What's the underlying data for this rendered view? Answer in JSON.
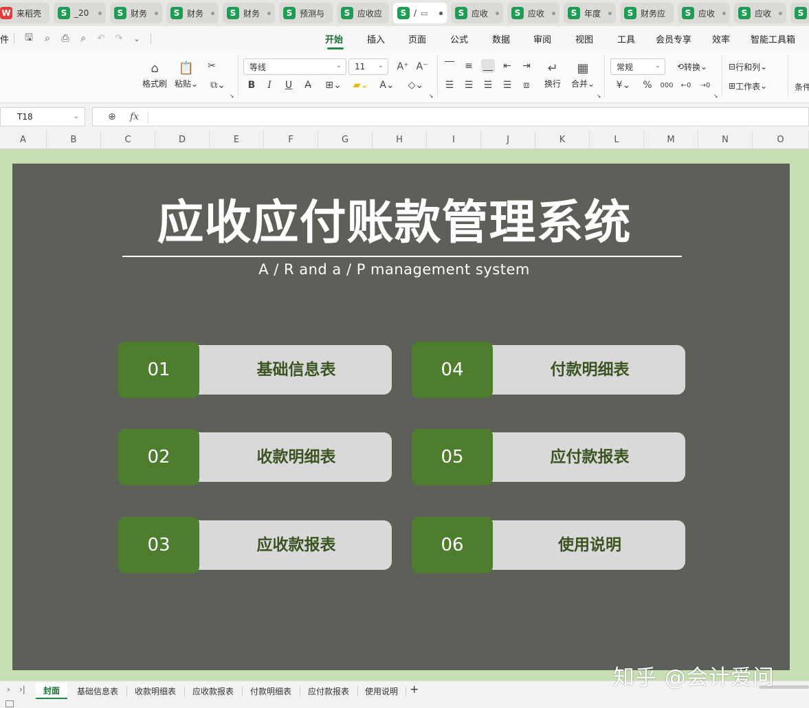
{
  "tabs": [
    {
      "icon": "W",
      "red": true,
      "title": "来稻壳"
    },
    {
      "icon": "S",
      "title": "_20"
    },
    {
      "icon": "S",
      "title": "财务"
    },
    {
      "icon": "S",
      "title": "财务"
    },
    {
      "icon": "S",
      "title": "财务"
    },
    {
      "icon": "S",
      "title": "预测与"
    },
    {
      "icon": "S",
      "title": "应收应"
    },
    {
      "icon": "S",
      "title": "/"
    },
    {
      "icon": "S",
      "title": "应收"
    },
    {
      "icon": "S",
      "title": "应收"
    },
    {
      "icon": "S",
      "title": "年度"
    },
    {
      "icon": "S",
      "title": "财务应"
    },
    {
      "icon": "S",
      "title": "应收"
    },
    {
      "icon": "S",
      "title": "应收"
    },
    {
      "icon": "S",
      "title": ""
    }
  ],
  "menu": {
    "file_partial": "件",
    "items": [
      "开始",
      "插入",
      "页面",
      "公式",
      "数据",
      "审阅",
      "视图",
      "工具",
      "会员专享",
      "效率",
      "智能工具箱"
    ]
  },
  "ribbon": {
    "format_painter": "格式刷",
    "paste": "粘贴",
    "font_name": "等线",
    "font_size": "11",
    "wrap": "换行",
    "merge": "合并",
    "number_format": "常规",
    "convert": "转换",
    "row_col": "行和列",
    "worksheet": "工作表",
    "cond_partial": "条件",
    "percent": "%",
    "yen": "¥",
    "bold": "B",
    "italic": "I",
    "underline": "U"
  },
  "formula": {
    "cell_ref": "T18",
    "fx": "fx",
    "value": ""
  },
  "columns": [
    "A",
    "B",
    "C",
    "D",
    "E",
    "F",
    "G",
    "H",
    "I",
    "J",
    "K",
    "L",
    "M",
    "N",
    "O"
  ],
  "cover": {
    "title": "应收应付账款管理系统",
    "subtitle": "A / R and a / P management system",
    "cards": [
      {
        "num": "01",
        "label": "基础信息表"
      },
      {
        "num": "02",
        "label": "收款明细表"
      },
      {
        "num": "03",
        "label": "应收款报表"
      },
      {
        "num": "04",
        "label": "付款明细表"
      },
      {
        "num": "05",
        "label": "应付款报表"
      },
      {
        "num": "06",
        "label": "使用说明"
      }
    ]
  },
  "sheet_tabs": [
    "封面",
    "基础信息表",
    "收款明细表",
    "应收款报表",
    "付款明细表",
    "应付款报表",
    "使用说明"
  ],
  "active_sheet": "封面",
  "watermark": "知乎 @会计爱问",
  "colors": {
    "accent": "#1f8a47",
    "panel": "#5c6058",
    "sheet_bg": "#c7dfb2",
    "card_num": "#4e7d2d",
    "card_label": "#d9d9d9",
    "card_text": "#3b5421"
  }
}
